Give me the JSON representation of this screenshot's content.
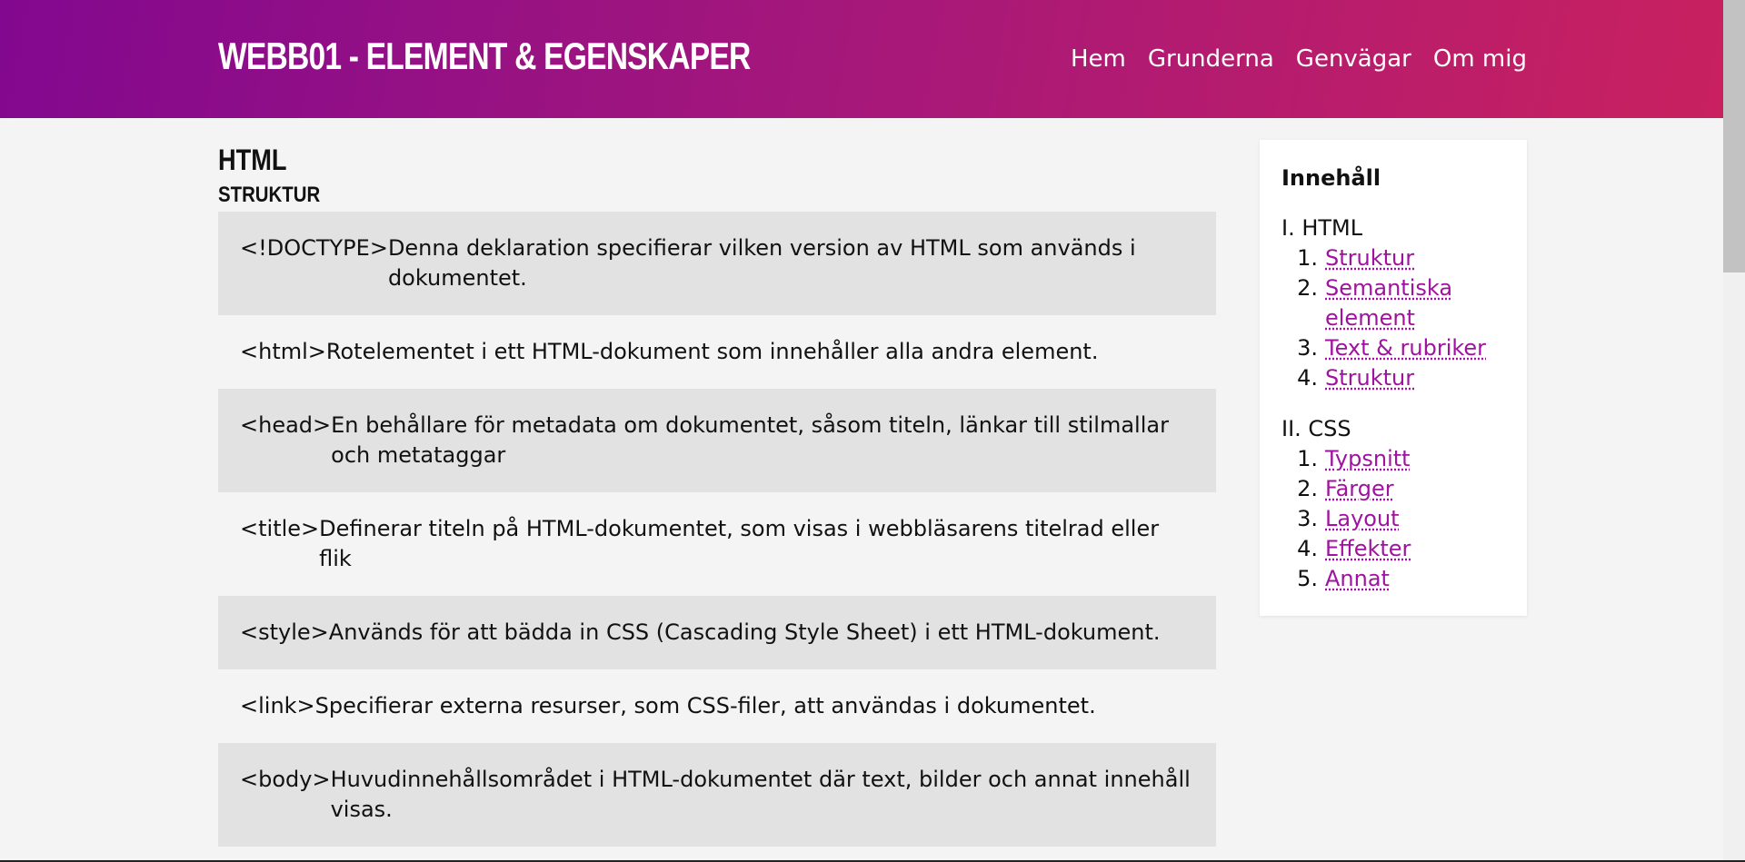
{
  "header": {
    "title": "WEBB01 - ELEMENT & EGENSKAPER",
    "nav": [
      "Hem",
      "Grunderna",
      "Genvägar",
      "Om mig"
    ]
  },
  "main": {
    "heading": "HTML",
    "subheading": "STRUKTUR",
    "elements": [
      {
        "tag": "<!DOCTYPE>",
        "desc": "Denna deklaration specifierar vilken version av HTML som används i dokumentet."
      },
      {
        "tag": "<html>",
        "desc": "Rotelementet i ett HTML-dokument som innehåller alla andra element."
      },
      {
        "tag": "<head>",
        "desc": "En behållare för metadata om dokumentet, såsom titeln, länkar till stilmallar och metataggar"
      },
      {
        "tag": "<title>",
        "desc": "Definerar titeln på HTML-dokumentet, som visas i webbläsarens titelrad eller flik"
      },
      {
        "tag": "<style>",
        "desc": "Används för att bädda in CSS (Cascading Style Sheet) i ett HTML-dokument."
      },
      {
        "tag": "<link>",
        "desc": "Specifierar externa resurser, som CSS-filer, att användas i dokumentet."
      },
      {
        "tag": "<body>",
        "desc": "Huvudinnehållsområdet i HTML-dokumentet där text, bilder och annat innehåll visas."
      }
    ]
  },
  "toc": {
    "title": "Innehåll",
    "groups": [
      {
        "label": "I. HTML",
        "items": [
          "Struktur",
          "Semantiska element",
          "Text & rubriker",
          "Struktur"
        ]
      },
      {
        "label": "II. CSS",
        "items": [
          "Typsnitt",
          "Färger",
          "Layout",
          "Effekter",
          "Annat"
        ]
      }
    ]
  },
  "colors": {
    "header_gradient_start": "#82088f",
    "header_gradient_end": "#c9215f",
    "link": "#a012a0",
    "row_shade": "#e2e2e2",
    "page_bg": "#f4f4f4"
  }
}
